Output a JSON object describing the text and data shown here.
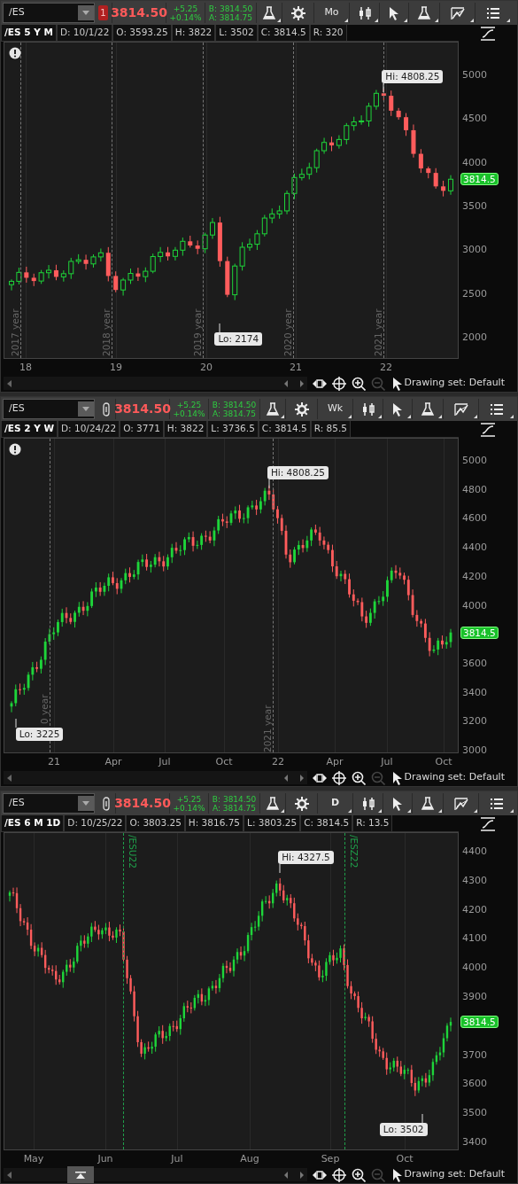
{
  "panels": [
    {
      "symbol": "/ES",
      "link": {
        "kind": "badge",
        "text": "1"
      },
      "price": "3814.50",
      "change": "+5.25",
      "change_pct": "+0.14%",
      "bid": "B: 3814.50",
      "ask": "A: 3814.75",
      "timeframe": "Mo",
      "study_title": "/ES 5 Y M",
      "ohlc": [
        "D: 10/1/22",
        "O: 3593.25",
        "H: 3822",
        "L: 3502",
        "C: 3814.5",
        "R: 320"
      ],
      "alert": true,
      "y_ticks": [
        "5000",
        "4500",
        "4000",
        "3500",
        "3000",
        "2500",
        "2000"
      ],
      "last_price": "3814.5",
      "hi_label": "Hi: 4808.25",
      "lo_label": "Lo: 2174",
      "markers": [
        {
          "kind": "year",
          "label": "2017 year"
        },
        {
          "kind": "year",
          "label": "2018 year"
        },
        {
          "kind": "year",
          "label": "2019 year"
        },
        {
          "kind": "year",
          "label": "2020 year"
        },
        {
          "kind": "year",
          "label": "2021 year"
        }
      ],
      "x_labels": [
        "18",
        "19",
        "20",
        "21",
        "22"
      ],
      "drawing_set": "Drawing set: Default",
      "collapse_handle": false
    },
    {
      "symbol": "/ES",
      "link": {
        "kind": "link-icon"
      },
      "price": "3814.50",
      "change": "+5.25",
      "change_pct": "+0.14%",
      "bid": "B: 3814.50",
      "ask": "A: 3814.75",
      "timeframe": "Wk",
      "study_title": "/ES 2 Y W",
      "ohlc": [
        "D: 10/24/22",
        "O: 3771",
        "H: 3822",
        "L: 3736.5",
        "C: 3814.5",
        "R: 85.5"
      ],
      "alert": true,
      "y_ticks": [
        "5000",
        "4800",
        "4600",
        "4400",
        "4200",
        "4000",
        "3600",
        "3400",
        "3200",
        "3000"
      ],
      "last_price": "3814.5",
      "hi_label": "Hi: 4808.25",
      "lo_label": "Lo: 3225",
      "markers": [
        {
          "kind": "year",
          "label": "0 year"
        },
        {
          "kind": "year",
          "label": "2021 year"
        }
      ],
      "x_labels": [
        "21",
        "Apr",
        "Jul",
        "Oct",
        "22",
        "Apr",
        "Jul",
        "Oct"
      ],
      "drawing_set": "Drawing set: Default",
      "collapse_handle": false
    },
    {
      "symbol": "/ES",
      "link": {
        "kind": "link-icon"
      },
      "price": "3814.50",
      "change": "+5.25",
      "change_pct": "+0.14%",
      "bid": "B: 3814.50",
      "ask": "A: 3814.75",
      "timeframe": "D",
      "study_title": "/ES 6 M 1D",
      "ohlc": [
        "D: 10/25/22",
        "O: 3803.25",
        "H: 3816.75",
        "L: 3803.25",
        "C: 3814.5",
        "R: 13.5"
      ],
      "alert": false,
      "y_ticks": [
        "4400",
        "4300",
        "4200",
        "4100",
        "4000",
        "3900",
        "3700",
        "3600",
        "3500",
        "3400"
      ],
      "last_price": "3814.5",
      "hi_label": "Hi: 4327.5",
      "lo_label": "Lo: 3502",
      "markers": [
        {
          "kind": "contract",
          "label": "/ESU22"
        },
        {
          "kind": "contract",
          "label": "/ESZ22"
        }
      ],
      "x_labels": [
        "May",
        "Jun",
        "Jul",
        "Aug",
        "Sep",
        "Oct"
      ],
      "drawing_set": "Drawing set: Default",
      "collapse_handle": true
    }
  ]
}
